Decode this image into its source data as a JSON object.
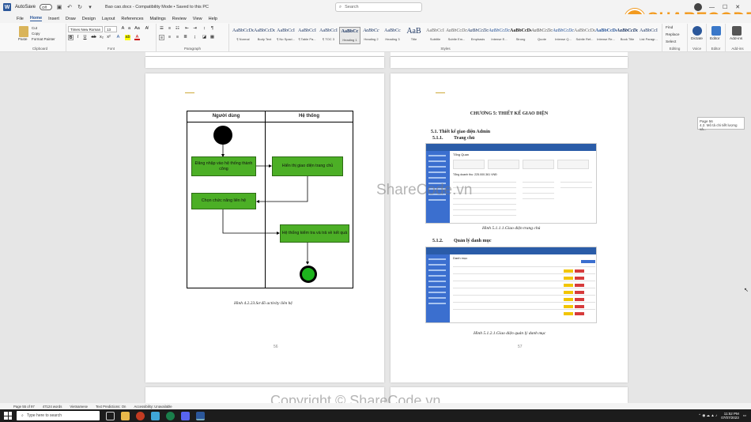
{
  "titlebar": {
    "autosave_label": "AutoSave",
    "autosave_state": "Off",
    "doc_title": "Bao cao.docx  -  Compatibility Mode  •  Saved to this PC",
    "search_placeholder": "Search",
    "minimize": "—",
    "maximize": "☐",
    "close": "✕"
  },
  "menu": [
    "File",
    "Home",
    "Insert",
    "Draw",
    "Design",
    "Layout",
    "References",
    "Mailings",
    "Review",
    "View",
    "Help"
  ],
  "ribbon": {
    "clipboard": {
      "paste": "Paste",
      "cut": "Cut",
      "copy": "Copy",
      "format_painter": "Format Painter",
      "label": "Clipboard"
    },
    "font": {
      "family": "Times New Roman",
      "size": "13",
      "label": "Font"
    },
    "paragraph": {
      "label": "Paragraph"
    },
    "styles": {
      "label": "Styles",
      "items": [
        {
          "sample": "AaBbCcDc",
          "name": "¶ Normal"
        },
        {
          "sample": "AaBbCcDc",
          "name": "Body Text"
        },
        {
          "sample": "AaBbCcI",
          "name": "¶ No Spaci..."
        },
        {
          "sample": "AaBbCcI",
          "name": "¶ Table Pa..."
        },
        {
          "sample": "AaBbCcI",
          "name": "¶ TOC 3"
        },
        {
          "sample": "AaBbCc",
          "name": "Heading 1"
        },
        {
          "sample": "AaBbCc",
          "name": "Heading 2"
        },
        {
          "sample": "AaBbCc",
          "name": "Heading 3"
        },
        {
          "sample": "AaB",
          "name": "Title"
        },
        {
          "sample": "AaBbCcI",
          "name": "Subtitle"
        },
        {
          "sample": "AaBbCcDc",
          "name": "Subtle Em..."
        },
        {
          "sample": "AaBbCcDc",
          "name": "Emphasis"
        },
        {
          "sample": "AaBbCcDc",
          "name": "Intense E..."
        },
        {
          "sample": "AaBbCcDc",
          "name": "Strong"
        },
        {
          "sample": "AaBbCcDc",
          "name": "Quote"
        },
        {
          "sample": "AaBbCcDc",
          "name": "Intense Q..."
        },
        {
          "sample": "AaBbCcDc",
          "name": "Subtle Ref..."
        },
        {
          "sample": "AaBbCcDc",
          "name": "Intense Re..."
        },
        {
          "sample": "AaBbCcDc",
          "name": "Book Title"
        },
        {
          "sample": "AaBbCcI",
          "name": "List Paragr..."
        }
      ]
    },
    "editing": {
      "find": "Find",
      "replace": "Replace",
      "select": "Select",
      "label": "Editing"
    },
    "voice": {
      "dictate": "Dictate",
      "label": "Voice"
    },
    "editor": {
      "editor": "Editor",
      "label": "Editor"
    },
    "addins": {
      "addins": "Add-ins",
      "label": "Add-ins"
    }
  },
  "page56": {
    "lane_user": "Người dùng",
    "lane_system": "Hệ thống",
    "act1": "Đăng nhập vào hệ thống thành công",
    "act2": "Hiển thị giao diện trang chủ",
    "act3": "Chọn chức năng liên hệ",
    "act4": "Hệ thống kiểm tra và trả về kết quả",
    "caption": "Hình 4.2.23.Sơ đồ activity liên hệ",
    "page_number": "56"
  },
  "page57": {
    "chapter": "CHƯƠNG 5: THIẾT KẾ GIAO DIỆN",
    "h_admin": "5.1. Thiết kế giao diện Admin",
    "h_home_num": "5.1.1.",
    "h_home": "Trang chủ",
    "shot1_title": "Tổng Quan",
    "shot1_revenue": "Tổng doanh thu: 225.000.361 VNĐ",
    "caption1": "Hình 5.1.1.1.Giao diện trang chủ",
    "h_cat_num": "5.1.2.",
    "h_cat": "Quản lý danh mục",
    "shot2_title": "Danh mục",
    "caption2": "Hình 5.1.2.1.Giao diện quản lý danh mục",
    "page_number": "57"
  },
  "tooltip": {
    "line1": "Page 56",
    "line2": "4.2. Mô tả chi tiết lượng và..."
  },
  "statusbar": {
    "page": "Page 55 of 97",
    "words": "47124 words",
    "lang": "Vietnamese",
    "predictions": "Text Predictions: On",
    "accessibility": "Accessibility: Unavailable"
  },
  "taskbar": {
    "search": "Type here to search",
    "time": "11:52 PM",
    "date": "07/07/2023"
  },
  "watermarks": {
    "center": "ShareCode.vn",
    "bottom": "Copyright © ShareCode.vn",
    "logo": "SHARECODE.vn"
  }
}
